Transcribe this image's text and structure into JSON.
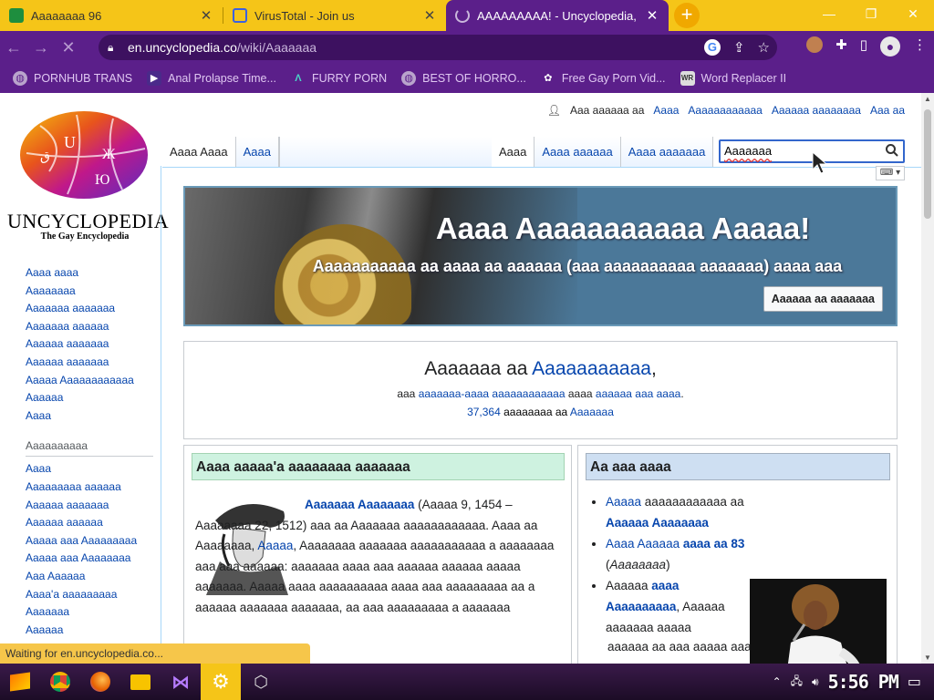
{
  "browser": {
    "tabs": [
      {
        "title": "Aaaaaaaa 96",
        "active": false
      },
      {
        "title": "VirusTotal - Join us",
        "active": false
      },
      {
        "title": "AAAAAAAAA! - Uncyclopedia,",
        "active": true
      }
    ],
    "url_host": "en.uncyclopedia.co",
    "url_path": "/wiki/Aaaaaaa",
    "bookmarks": [
      "PORNHUB TRANS",
      "Anal Prolapse Time...",
      "FURRY PORN",
      "BEST OF HORRO...",
      "Free Gay Porn Vid...",
      "Word Replacer II"
    ]
  },
  "site": {
    "logo_name": "UNCYCLOPEDIA",
    "logo_sub": "The Gay Encyclopedia",
    "personal_links": [
      "Aaa aaaaaa aa",
      "Aaaa",
      "Aaaaaaaaaaaa",
      "Aaaaaa aaaaaaaa",
      "Aaa aa"
    ],
    "tabs_left": [
      "Aaaa Aaaa",
      "Aaaa"
    ],
    "tabs_right": [
      "Aaaa",
      "Aaaa aaaaaa",
      "Aaaa aaaaaaa"
    ],
    "search_value": "Aaaaaaa"
  },
  "sidebar": {
    "group1": [
      "Aaaa aaaa",
      "Aaaaaaaa",
      "Aaaaaaa aaaaaaa",
      "Aaaaaaa aaaaaa",
      "Aaaaaa aaaaaaa",
      "Aaaaaa aaaaaaa",
      "Aaaaa Aaaaaaaaaaaa",
      "Aaaaaa",
      "Aaaa"
    ],
    "group2_heading": "Aaaaaaaaaa",
    "group2": [
      "Aaaa",
      "Aaaaaaaaa aaaaaa",
      "Aaaaaa aaaaaaa",
      "Aaaaaa aaaaaa",
      "Aaaaa aaa Aaaaaaaaa",
      "Aaaaa aaa Aaaaaaaa",
      "Aaa Aaaaaa",
      "Aaaa'a aaaaaaaaa",
      "Aaaaaaa",
      "Aaaaaa"
    ]
  },
  "banner": {
    "headline": "Aaaa Aaaaaaaaaaa Aaaaa!",
    "subline": "Aaaaaaaaaaa aa aaaa aa aaaaaa (aaa aaaaaaaaaa aaaaaaa) aaaa aaa",
    "button": "Aaaaaa aa aaaaaaa"
  },
  "welcome": {
    "line1_prefix": "Aaaaaaa aa ",
    "line1_link": "Aaaaaaaaaaa",
    "line1_suffix": ",",
    "line2_prefix": "aaa ",
    "line2_link": "aaaaaaa-aaaa aaaaaaaaaaaa",
    "line2_mid": " aaaa ",
    "line2_link2": "aaaaaa aaa aaaa",
    "line2_suffix": ".",
    "count": "37,364",
    "line3_mid": " aaaaaaaa aa ",
    "line3_link": "Aaaaaaa"
  },
  "featured": {
    "header": "Aaaa aaaaa'a aaaaaaaa aaaaaaa",
    "title_link": "Aaaaaaa Aaaaaaaa",
    "text1": " (Aaaaa 9, 1454 – Aaaaaaaa 22, 1512) aaa aa Aaaaaaa aaaaaaaaaaaa. Aaaa aa Aaaaaaaa, ",
    "link2": "Aaaaa",
    "text2": ", Aaaaaaaa aaaaaaa aaaaaaaaaaa a aaaaaaaa aaa aaa aaaaaa: aaaaaaa aaaa aaa aaaaaa aaaaaa aaaaa aaaaaaa. Aaaaa aaaa aaaaaaaaaa aaaa aaa aaaaaaaaa aa a aaaaaa aaaaaaa aaaaaaa, aa aaa aaaaaaaaa a aaaaaaa"
  },
  "news": {
    "header": "Aa aaa aaaa",
    "items": [
      {
        "link": "Aaaaa",
        "text": " aaaaaaaaaaaa aa ",
        "bold": "Aaaaaa Aaaaaaaa"
      },
      {
        "link": "Aaaa Aaaaaa",
        "bold_suffix": "aaaa aa 83",
        "italic": "Aaaaaaaa"
      },
      {
        "text": "Aaaaaa ",
        "bold": "aaaa Aaaaaaaaaa",
        "tail": ", Aaaaaa aaaaaaa aaaaa"
      }
    ],
    "tail": "aaaaaa aa aaa aaaaa aaaaa Aaaaaa Aaaaa"
  },
  "status_text": "Waiting for en.uncyclopedia.co...",
  "taskbar": {
    "clock": "5:56 PM"
  },
  "colors": {
    "accent": "#5b1f8a",
    "tabbar": "#f5c518",
    "link": "#0645ad"
  }
}
